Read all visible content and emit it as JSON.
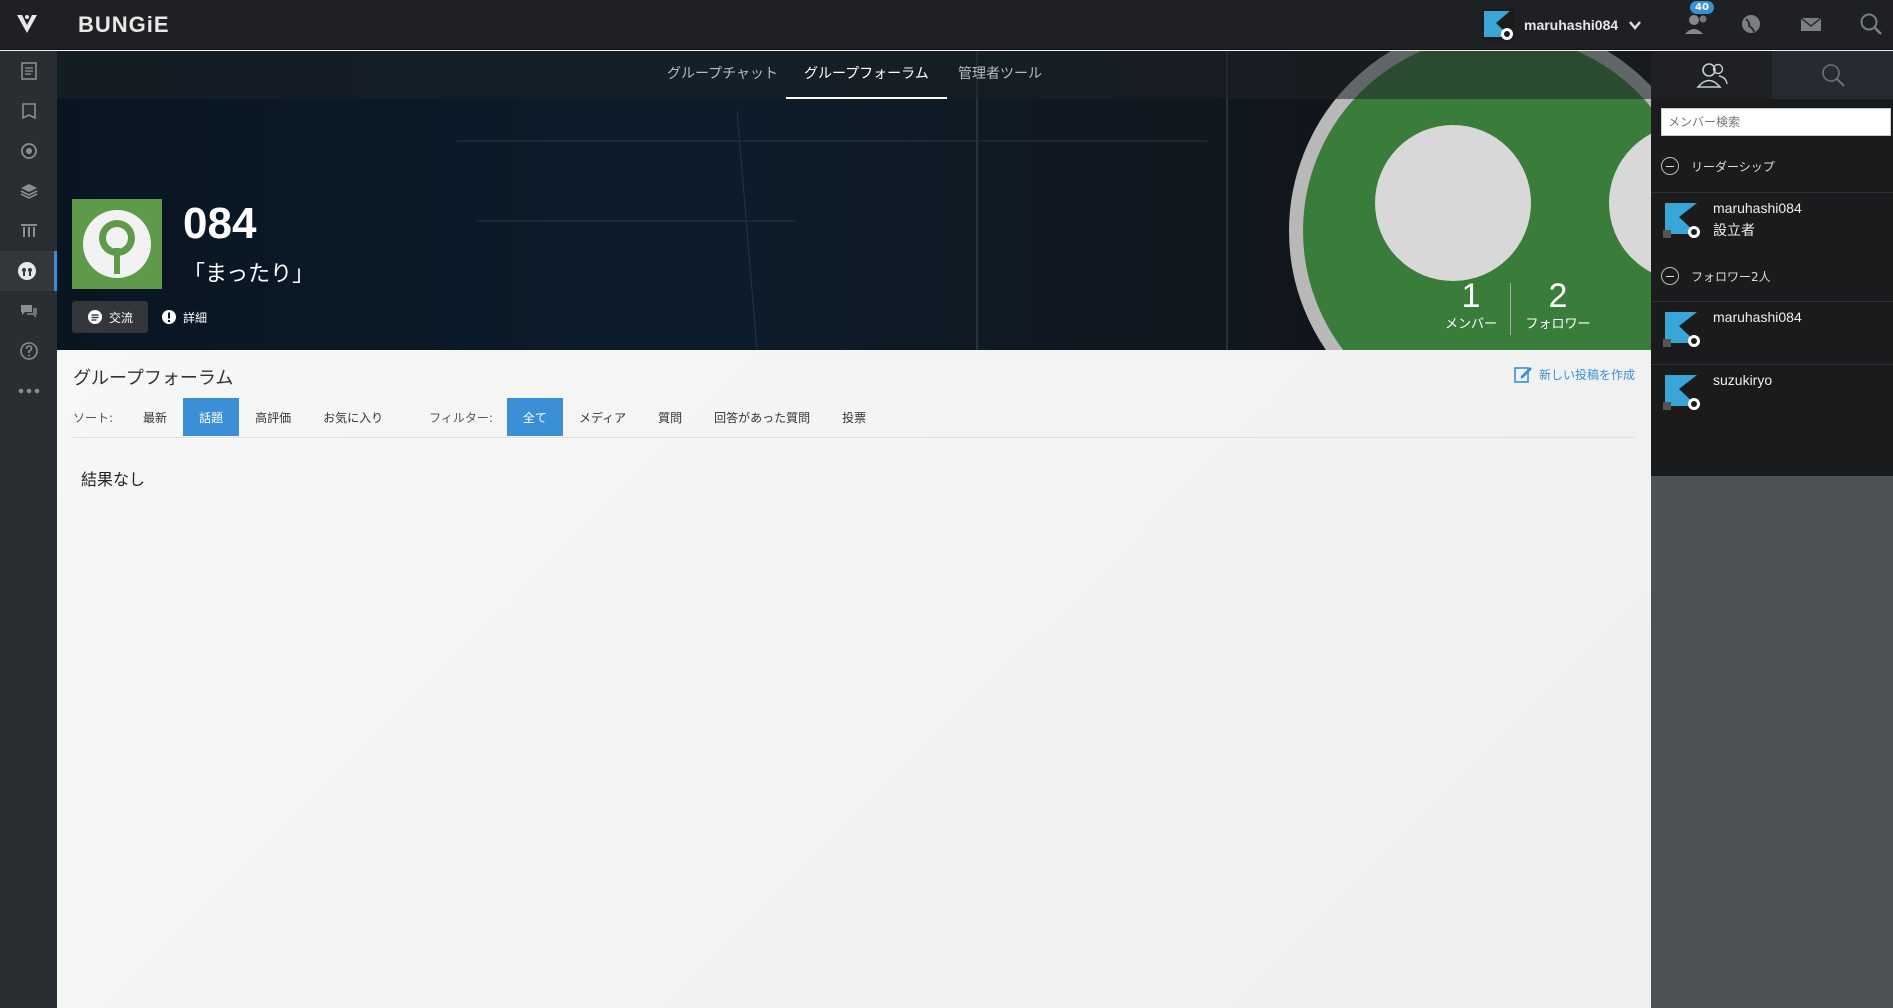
{
  "header": {
    "brand": "BUNGiE",
    "username": "maruhashi084",
    "notification_count": "40"
  },
  "group_tabs": [
    {
      "label": "グループチャット"
    },
    {
      "label": "グループフォーラム"
    },
    {
      "label": "管理者ツール"
    }
  ],
  "group": {
    "name": "084",
    "motto": "「まったり」",
    "chat_button": "交流",
    "detail_button": "詳細",
    "members_count": "1",
    "members_label": "メンバー",
    "followers_count": "2",
    "followers_label": "フォロワー"
  },
  "forum": {
    "title": "グループフォーラム",
    "new_post": "新しい投稿を作成",
    "sort_label": "ソート:",
    "sort_options": [
      "最新",
      "話題",
      "高評価",
      "お気に入り"
    ],
    "sort_selected": "話題",
    "filter_label": "フィルター:",
    "filter_options": [
      "全て",
      "メディア",
      "質問",
      "回答があった質問",
      "投票"
    ],
    "filter_selected": "全て",
    "empty_message": "結果なし"
  },
  "side_panel": {
    "search_placeholder": "メンバー検索",
    "leadership_label": "リーダーシップ",
    "followers_label": "フォロワー2人",
    "leaders": [
      {
        "name": "maruhashi084",
        "role": "設立者"
      }
    ],
    "followers": [
      {
        "name": "maruhashi084"
      },
      {
        "name": "suzukiryo"
      }
    ]
  },
  "colors": {
    "accent": "#3a8fd6",
    "topbar": "#1e2023",
    "sidebar": "#2a2d31"
  },
  "icons": {
    "nav": [
      "destiny-logo-icon",
      "news-icon",
      "codex-icon",
      "ghost-icon",
      "layers-icon",
      "pillars-icon",
      "clan-icon",
      "forum-bubble-icon",
      "help-icon",
      "more-dots-icon"
    ]
  }
}
